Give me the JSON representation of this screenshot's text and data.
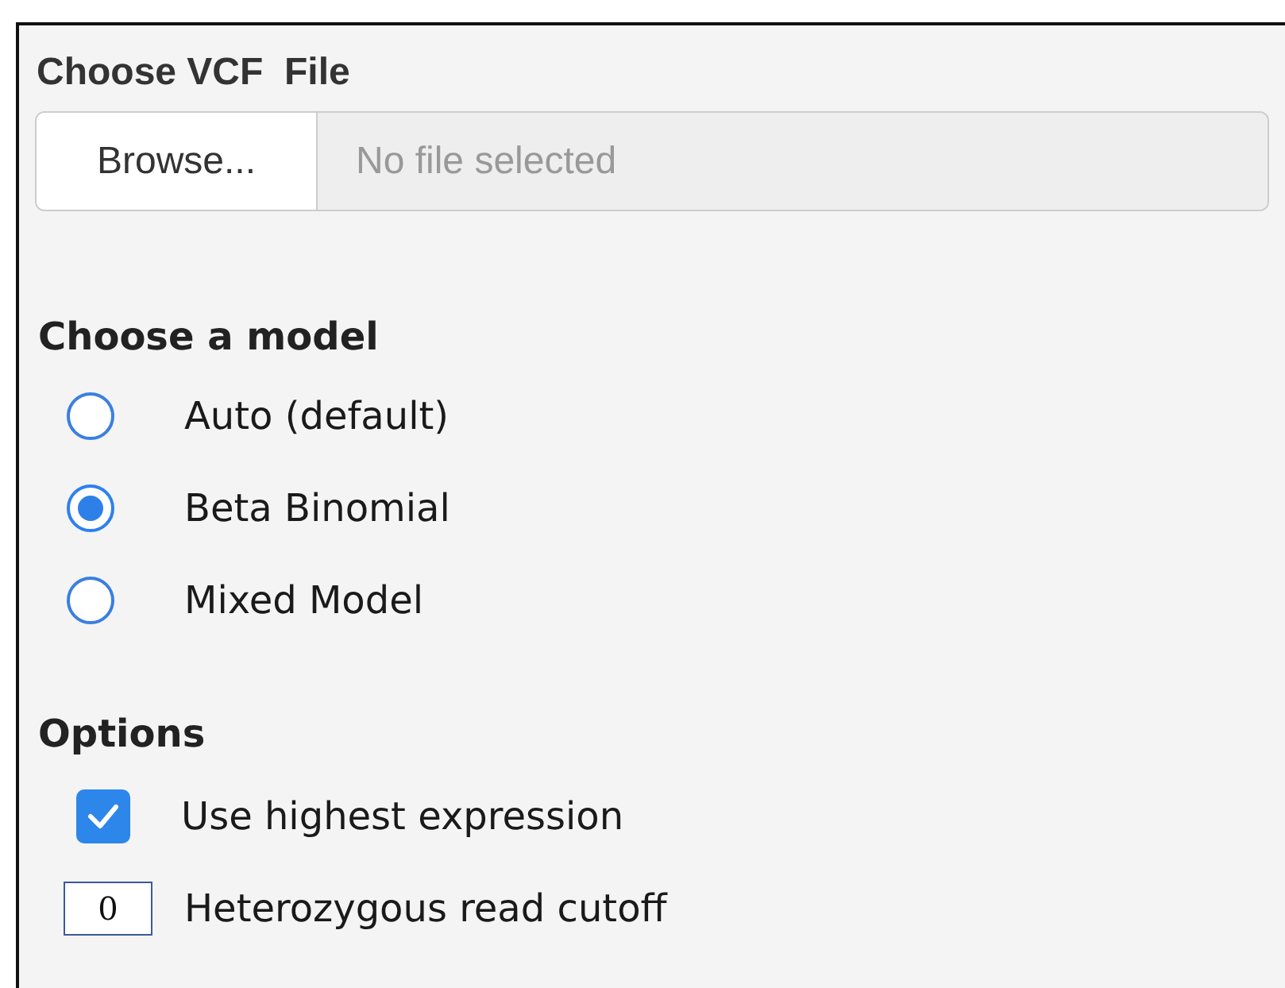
{
  "file_input": {
    "label": "Choose VCF  File",
    "button": "Browse...",
    "placeholder": "No file selected"
  },
  "model": {
    "heading": "Choose a model",
    "options": [
      {
        "label": "Auto (default)",
        "selected": false
      },
      {
        "label": "Beta Binomial",
        "selected": true
      },
      {
        "label": "Mixed Model",
        "selected": false
      }
    ]
  },
  "options": {
    "heading": "Options",
    "items": [
      {
        "kind": "checkbox",
        "label": "Use highest expression",
        "checked": true
      },
      {
        "kind": "number",
        "label": "Heterozygous read cutoff",
        "value": "0"
      }
    ]
  }
}
